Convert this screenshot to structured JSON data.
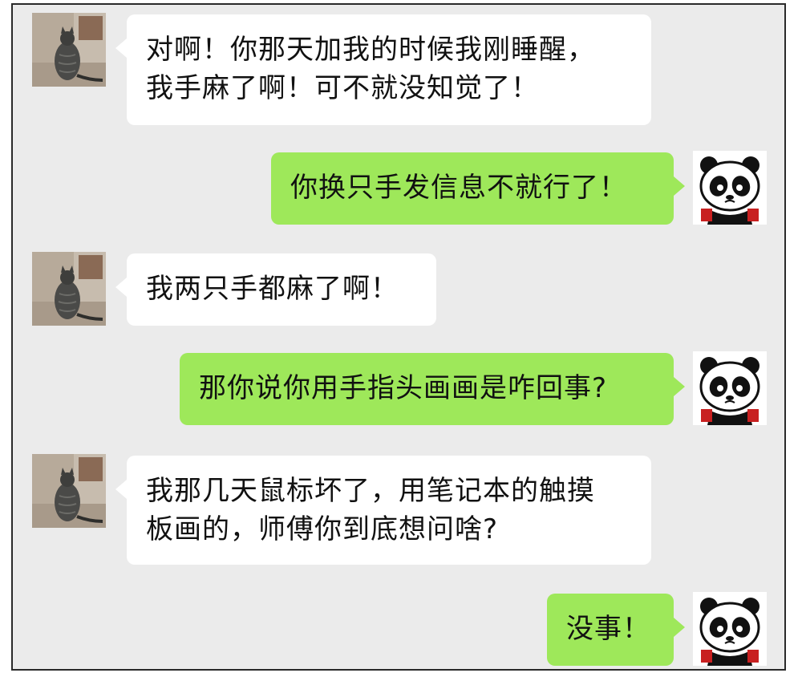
{
  "chat": {
    "messages": [
      {
        "sender": "them",
        "lines": [
          "对啊！你那天加我的时候我刚睡醒，",
          "我手麻了啊！可不就没知觉了！"
        ]
      },
      {
        "sender": "me",
        "lines": [
          "你换只手发信息不就行了！"
        ]
      },
      {
        "sender": "them",
        "lines": [
          "我两只手都麻了啊！"
        ]
      },
      {
        "sender": "me",
        "lines": [
          "那你说你用手指头画画是咋回事?"
        ]
      },
      {
        "sender": "them",
        "lines": [
          "我那几天鼠标坏了，用笔记本的触摸",
          "板画的，师傅你到底想问啥?"
        ]
      },
      {
        "sender": "me",
        "lines": [
          "没事！"
        ]
      }
    ]
  },
  "avatars": {
    "them": "cat-photo-icon",
    "me": "panda-sticker-icon"
  },
  "colors": {
    "background": "#ebebeb",
    "bubble_them": "#ffffff",
    "bubble_me": "#9ee85a",
    "text": "#111111"
  }
}
